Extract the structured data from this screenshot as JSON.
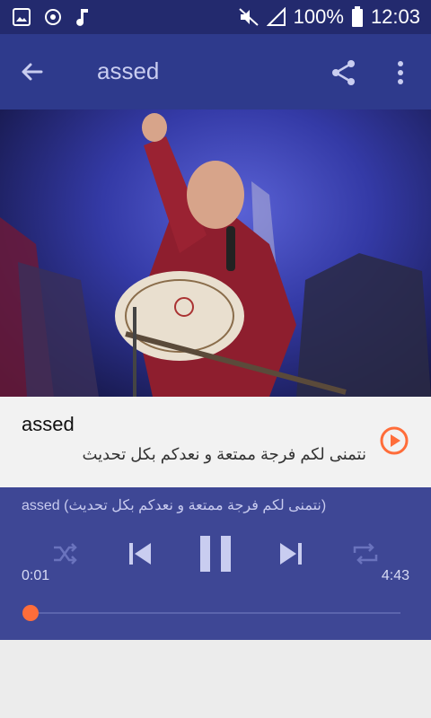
{
  "status_bar": {
    "battery": "100%",
    "time": "12:03",
    "icons": [
      "image-icon",
      "sync-icon",
      "music-note-icon",
      "mute-icon",
      "signal-icon",
      "battery-icon"
    ]
  },
  "app_bar": {
    "title": "assed",
    "icons": [
      "back-arrow-icon",
      "share-icon",
      "more-vert-icon"
    ]
  },
  "song": {
    "title": "assed",
    "subtitle": "نتمنى لكم فرجة ممتعة و نعدكم بكل تحديث"
  },
  "player": {
    "now_playing": "assed (نتمنى لكم فرجة ممتعة و نعدكم بكل تحديث)",
    "elapsed": "0:01",
    "duration": "4:43",
    "progress": 0.004
  },
  "colors": {
    "status_bar": "#232a6e",
    "app_bar": "#2e3a8c",
    "player": "#3e4795",
    "accent": "#ff6d3a"
  }
}
